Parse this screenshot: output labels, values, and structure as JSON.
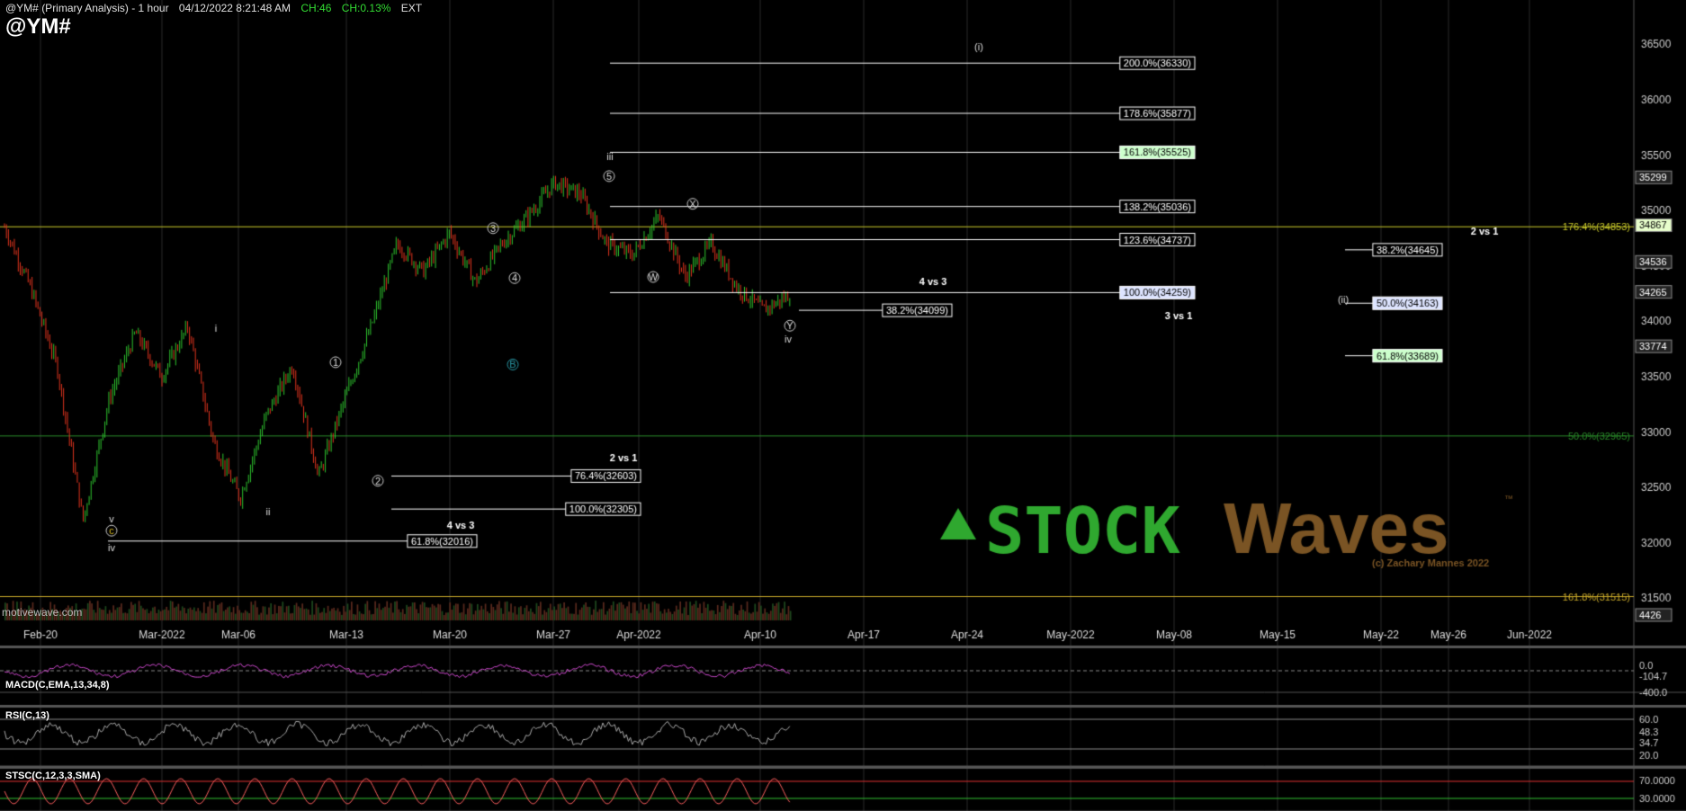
{
  "header": {
    "title": "@YM# (Primary Analysis) - 1 hour",
    "datetime": "04/12/2022 8:21:48 AM",
    "ch": "CH:46",
    "ch_pct": "CH:0.13%",
    "session": "EXT",
    "symbol": "@YM#"
  },
  "watermark": "motivewave.com",
  "logo": {
    "text": "STOCKWaves",
    "tm": "™",
    "credit": "(c) Zachary Mannes 2022"
  },
  "colors": {
    "bg": "#000000",
    "grid": "#2a2a2a",
    "up": "#2ec42e",
    "down": "#e0341e",
    "fib": "#ffffff",
    "logo_green": "#2fa82f",
    "logo_brown": "#7a5424"
  },
  "chart_data": [
    {
      "type": "candlestick",
      "title": "@YM#",
      "x_dates": [
        "Feb-20",
        "Mar-2022",
        "Mar-06",
        "Mar-13",
        "Mar-20",
        "Mar-27",
        "Apr-2022",
        "Apr-10",
        "Apr-17",
        "Apr-24",
        "May-2022",
        "May-08",
        "May-15",
        "May-22",
        "May-26",
        "Jun-2022"
      ],
      "price_ticks": [
        36500,
        36000,
        35500,
        35000,
        34500,
        34000,
        33500,
        33000,
        32500,
        32000,
        31500
      ],
      "ylim": [
        31300,
        36900
      ],
      "price_path": {
        "points": [
          [
            "Feb-20",
            34850
          ],
          [
            "",
            34300
          ],
          [
            "",
            33600
          ],
          [
            "",
            32200
          ],
          [
            "",
            33300
          ],
          [
            "Mar-2022",
            33900
          ],
          [
            "",
            33500
          ],
          [
            "",
            33950
          ],
          [
            "Mar-06",
            32900
          ],
          [
            "",
            32400
          ],
          [
            "",
            33150
          ],
          [
            "",
            33600
          ],
          [
            "Mar-13",
            32600
          ],
          [
            "",
            33300
          ],
          [
            "",
            33950
          ],
          [
            "Mar-20",
            34700
          ],
          [
            "",
            34450
          ],
          [
            "",
            34800
          ],
          [
            "",
            34350
          ],
          [
            "",
            34700
          ],
          [
            "Mar-27",
            34950
          ],
          [
            "",
            35250
          ],
          [
            "",
            35150
          ],
          [
            "Apr-2022",
            34700
          ],
          [
            "",
            34600
          ],
          [
            "",
            34950
          ],
          [
            "",
            34400
          ],
          [
            "Apr-10",
            34700
          ],
          [
            "",
            34300
          ],
          [
            "",
            34100
          ],
          [
            "",
            34240
          ]
        ]
      },
      "right_price_labels": [
        "35299",
        "34867",
        "34536",
        "34265",
        "33774",
        "4426"
      ],
      "fib_levels": [
        {
          "label": "200.0%(36330)",
          "value": 36330
        },
        {
          "label": "178.6%(35877)",
          "value": 35877
        },
        {
          "label": "161.8%(35525)",
          "value": 35525,
          "highlight": "#ccffcc"
        },
        {
          "label": "138.2%(35036)",
          "value": 35036
        },
        {
          "label": "123.6%(34737)",
          "value": 34737
        },
        {
          "label": "100.0%(34259)",
          "value": 34259,
          "highlight": "#dde4ff"
        },
        {
          "label": "38.2%(34099)",
          "value": 34099
        },
        {
          "label": "76.4%(32603)",
          "value": 32603
        },
        {
          "label": "100.0%(32305)",
          "value": 32305
        },
        {
          "label": "61.8%(32016)",
          "value": 32016
        },
        {
          "label": "38.2%(34645)",
          "value": 34645
        },
        {
          "label": "50.0%(34163)",
          "value": 34163,
          "highlight": "#dde4ff"
        },
        {
          "label": "61.8%(33689)",
          "value": 33689,
          "highlight": "#ccffcc"
        }
      ],
      "horizontal_levels": [
        {
          "label": "176.4%(34853)",
          "value": 34853,
          "color": "#c9c92a"
        },
        {
          "label": "50.0%(32965)",
          "value": 32965,
          "color": "#2a8a2a"
        },
        {
          "label": "161.8%(31515)",
          "value": 31515,
          "color": "#c9a92a"
        }
      ],
      "annotations": [
        "2 vs 1",
        "4 vs 3",
        "2 vs 1",
        "4 vs 3",
        "3 vs 1"
      ],
      "wave_labels": [
        "(i)",
        "iii",
        "5",
        "3",
        "4",
        "X",
        "W",
        "Y",
        "iv",
        "B",
        "1",
        "2",
        "i",
        "ii",
        "v",
        "c",
        "iv",
        "(ii)"
      ]
    },
    {
      "type": "line",
      "title": "MACD(C,EMA,13,34,8)",
      "labels": [
        "0.0",
        "-104.7",
        "-400.0"
      ],
      "values": [
        0,
        -104.7,
        -400
      ]
    },
    {
      "type": "line",
      "title": "RSI(C,13)",
      "labels": [
        "60.0",
        "48.3",
        "34.7",
        "20.0"
      ],
      "values": [
        60,
        48.3,
        34.7,
        20
      ]
    },
    {
      "type": "line",
      "title": "STSC(C,12,3,3,SMA)",
      "labels": [
        "70.0000",
        "30.0000"
      ],
      "values": [
        70,
        30
      ]
    }
  ]
}
